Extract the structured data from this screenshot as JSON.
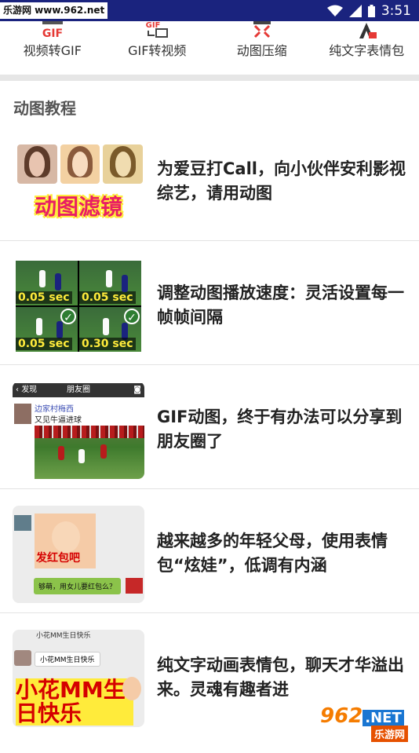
{
  "status_bar": {
    "watermark_text": "乐游网 www.962.net",
    "time": "3:51",
    "icons": [
      "wifi-icon",
      "signal-icon",
      "battery-icon"
    ]
  },
  "toolbar": {
    "tools": [
      {
        "label": "视频转GIF",
        "icon": "video-to-gif-icon",
        "icon_text": "GIF"
      },
      {
        "label": "GIF转视频",
        "icon": "gif-to-video-icon",
        "icon_text": "GIF"
      },
      {
        "label": "动图压缩",
        "icon": "compress-icon"
      },
      {
        "label": "纯文字表情包",
        "icon": "text-sticker-icon"
      }
    ]
  },
  "section": {
    "title": "动图教程"
  },
  "articles": [
    {
      "title": "为爱豆打Call，向小伙伴安利影视综艺，请用动图",
      "thumb_caption": "动图滤镜"
    },
    {
      "title": "调整动图播放速度：灵活设置每一帧帧间隔",
      "thumb_labels": [
        "0.05 sec",
        "0.05 sec",
        "0.05 sec",
        "0.30 sec"
      ]
    },
    {
      "title": "GIF动图，终于有办法可以分享到朋友圈了",
      "thumb_back": "发现",
      "thumb_header": "朋友圈",
      "thumb_name": "边家村梅西",
      "thumb_msg": "又见牛逼进球"
    },
    {
      "title": "越来越多的年轻父母，使用表情包“炫娃”，低调有内涵",
      "thumb_caption": "发红包吧",
      "thumb_bubble": "够萌，用女儿要红包么？"
    },
    {
      "title": "纯文字动画表情包，聊天才华溢出来。灵魂有趣者进",
      "thumb_line1": "小花MM生日快乐",
      "thumb_pill": "小花MM生日快乐",
      "thumb_big": "小花MM生日快乐"
    }
  ],
  "logo": {
    "number": "962",
    "net": ".NET",
    "sub": "乐游网"
  },
  "colors": {
    "status_bar": "#1a237e",
    "accent_red": "#e91e63"
  }
}
